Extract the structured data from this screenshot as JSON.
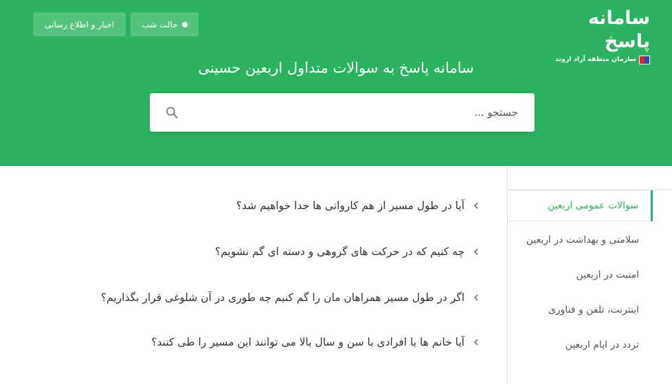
{
  "header": {
    "logo_title": "سامانه پاسخ",
    "logo_subtitle": "سازمان منطقه آزاد اروند",
    "night_mode_label": "حالت شب",
    "news_label": "اخبار و اطلاع رسانی",
    "hero_title": "سامانه پاسخ به سوالات متداول اربعین حسینی",
    "accent_color": "#2cb35f"
  },
  "search": {
    "placeholder": "جستجو ..."
  },
  "questions": [
    {
      "text": "آیا در طول مسیر از هم کاروانی ها جدا خواهیم شد؟"
    },
    {
      "text": "چه کنیم که در حرکت های گروهی و دسته ای گم نشویم؟"
    },
    {
      "text": "اگر در طول مسیر همراهان مان را گم کنیم چه طوری در آن شلوغی قرار بگذاریم؟"
    },
    {
      "text": "آیا خانم ها یا افرادی با سن و سال بالا می توانند این مسیر را طی کنند؟"
    }
  ],
  "sidebar": {
    "items": [
      {
        "label": "سوالات عمومی اربعین",
        "active": true
      },
      {
        "label": "سلامتی و بهداشت در اربعین",
        "active": false
      },
      {
        "label": "امنیت در اربعین",
        "active": false
      },
      {
        "label": "اینترنت، تلفن و فناوری",
        "active": false
      },
      {
        "label": "تردد در ایام اربعین",
        "active": false
      }
    ]
  }
}
